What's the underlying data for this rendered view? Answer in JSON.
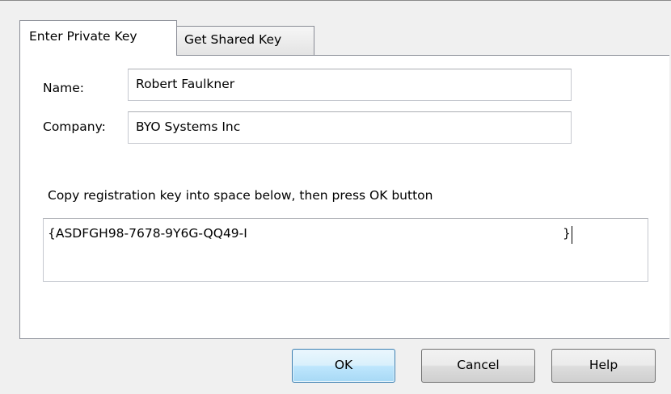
{
  "tabs": [
    {
      "label": "Enter Private Key",
      "active": true
    },
    {
      "label": "Get Shared Key",
      "active": false
    }
  ],
  "form": {
    "name_label": "Name:",
    "name_value": "Robert Faulkner",
    "company_label": "Company:",
    "company_value": "BYO Systems Inc",
    "instruction": "Copy registration key into space below, then press OK button",
    "key_value": "{ASDFGH98-7678-9Y6G-QQ49-I",
    "key_closing": "}"
  },
  "buttons": {
    "ok_label": "OK",
    "cancel_label": "Cancel",
    "help_label": "Help"
  },
  "colors": {
    "dialog_background": "#f0f0f0",
    "panel_background": "#ffffff",
    "default_button_border": "#3c7fb1"
  }
}
